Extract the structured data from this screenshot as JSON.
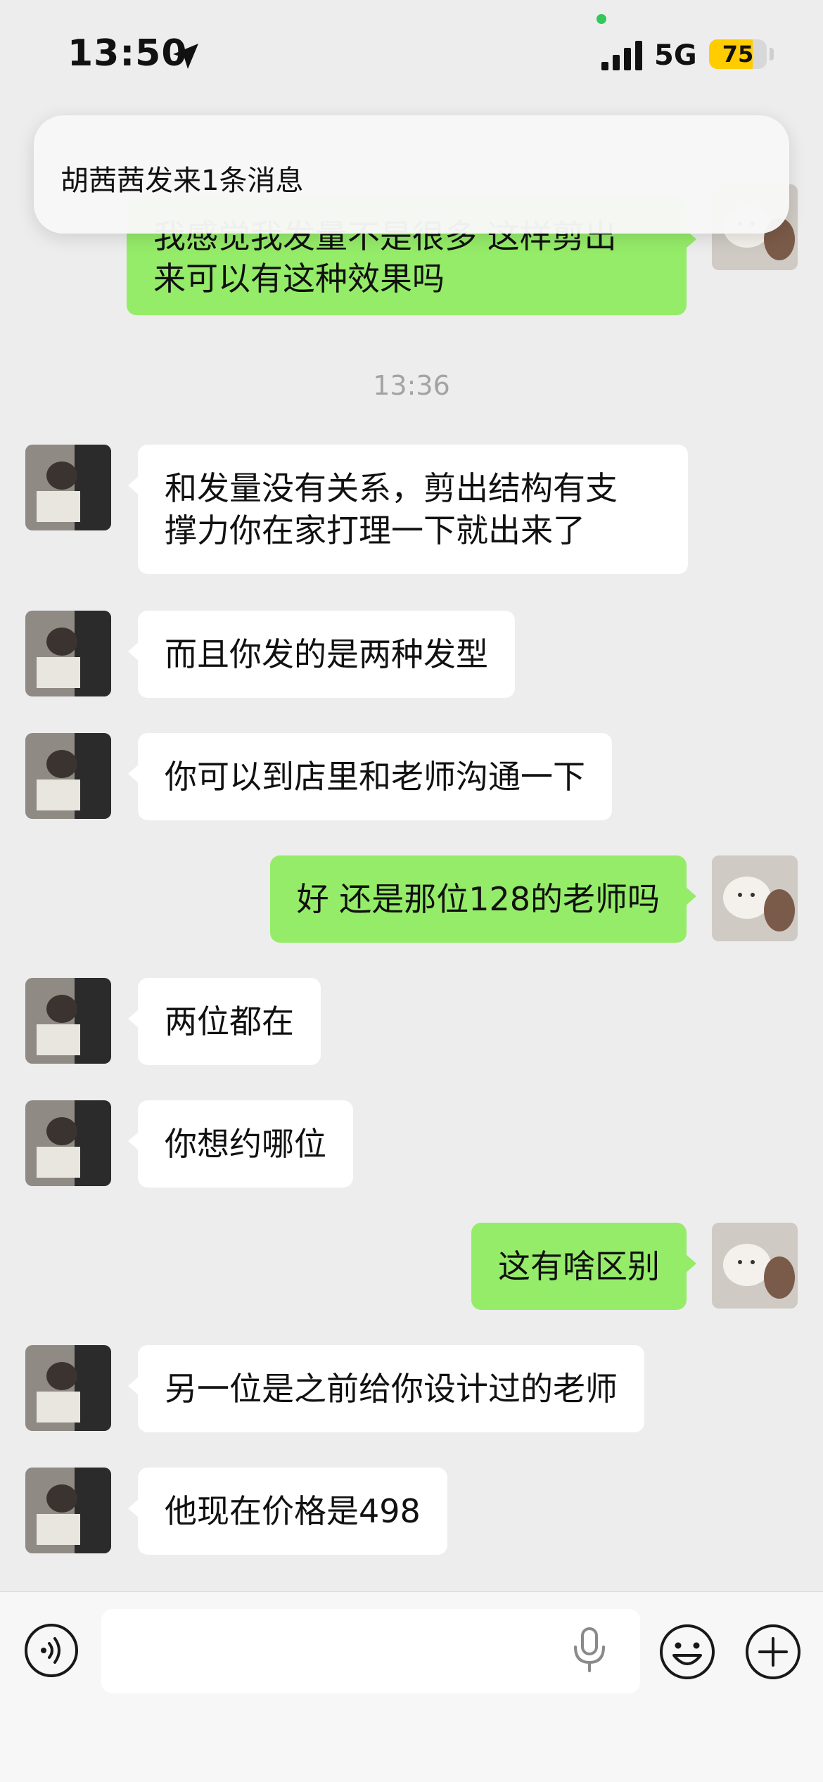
{
  "status_bar": {
    "time": "13:50",
    "network": "5G",
    "battery": "75",
    "battery_level_percent": 75,
    "icons": [
      "location-arrow-icon",
      "signal-bars-icon",
      "battery-icon"
    ]
  },
  "notification": {
    "text": "胡茜茜发来1条消息"
  },
  "chat": {
    "partial_message": {
      "line1": "我感觉我发量不是很多 这样剪出",
      "line2": "来可以有这种效果吗"
    },
    "timestamp": "13:36",
    "messages": [
      {
        "side": "in",
        "text": "和发量没有关系，剪出结构有支",
        "text2": "撑力你在家打理一下就出来了"
      },
      {
        "side": "in",
        "text": "而且你发的是两种发型"
      },
      {
        "side": "in",
        "text": "你可以到店里和老师沟通一下"
      },
      {
        "side": "out",
        "text": "好 还是那位128的老师吗"
      },
      {
        "side": "in",
        "text": "两位都在"
      },
      {
        "side": "in",
        "text": "你想约哪位"
      },
      {
        "side": "out",
        "text": "这有啥区别"
      },
      {
        "side": "in",
        "text": "另一位是之前给你设计过的老师"
      },
      {
        "side": "in",
        "text": "他现在价格是498"
      }
    ]
  },
  "input_bar": {
    "icons": [
      "voice-mode-icon",
      "microphone-icon",
      "emoji-icon",
      "plus-icon"
    ],
    "placeholder": ""
  },
  "colors": {
    "background": "#ededed",
    "outgoing_bubble": "#95ec69",
    "incoming_bubble": "#ffffff",
    "battery_fill": "#ffcc00"
  }
}
